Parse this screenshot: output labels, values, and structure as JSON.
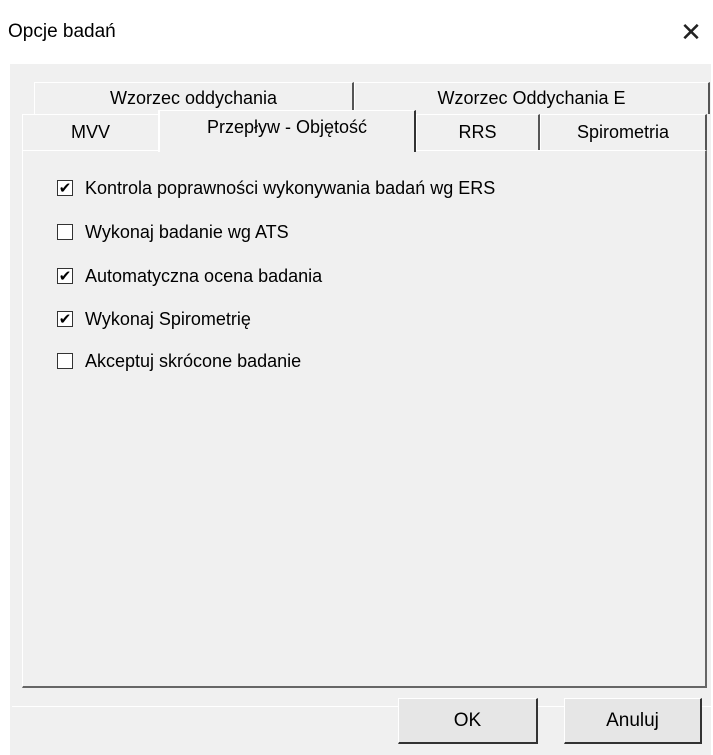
{
  "window": {
    "title": "Opcje badań",
    "close_glyph": "✕"
  },
  "tabs": {
    "row1": [
      {
        "label": "Wzorzec oddychania"
      },
      {
        "label": "Wzorzec Oddychania E"
      }
    ],
    "row2": [
      {
        "label": "MVV"
      },
      {
        "label": "Przepływ - Objętość",
        "active": true
      },
      {
        "label": "RRS"
      },
      {
        "label": "Spirometria"
      }
    ]
  },
  "options": [
    {
      "label": "Kontrola poprawności wykonywania badań wg ERS",
      "checked": true
    },
    {
      "label": "Wykonaj badanie wg ATS",
      "checked": false
    },
    {
      "label": "Automatyczna ocena badania",
      "checked": true
    },
    {
      "label": "Wykonaj Spirometrię",
      "checked": true
    },
    {
      "label": "Akceptuj skrócone badanie",
      "checked": false
    }
  ],
  "buttons": {
    "ok": "OK",
    "cancel": "Anuluj"
  },
  "colors": {
    "background": "#f0f0f0",
    "titlebar": "#ffffff"
  },
  "check_glyph": "✔"
}
